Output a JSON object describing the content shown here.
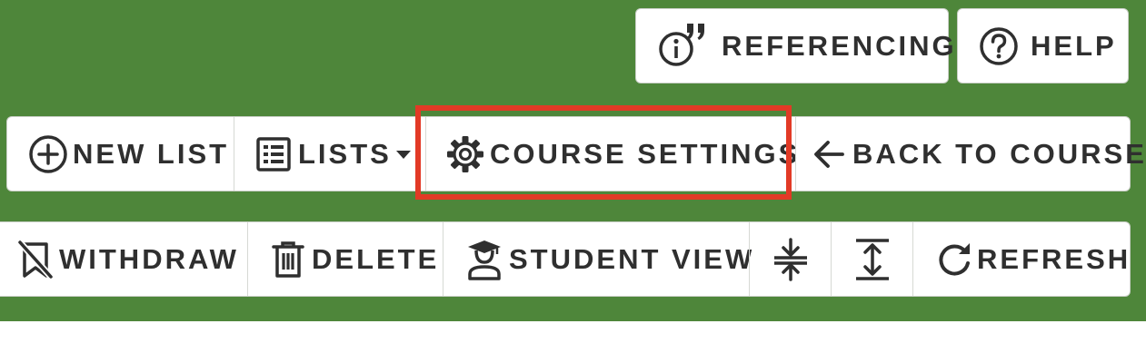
{
  "header": {
    "referencing_label": "REFERENCING",
    "help_label": "HELP"
  },
  "list_toolbar": {
    "new_list_label": "NEW LIST",
    "lists_label": "LISTS",
    "course_settings_label": "COURSE SETTINGS",
    "back_to_course_label": "BACK TO COURSE"
  },
  "item_toolbar": {
    "withdraw_label": "WITHDRAW",
    "delete_label": "DELETE",
    "student_view_label": "STUDENT VIEW",
    "refresh_label": "REFRESH"
  },
  "icons": {
    "referencing": "info-quote-icon",
    "help": "question-circle-icon",
    "new_list": "plus-circle-icon",
    "lists": "list-icon",
    "lists_dropdown": "caret-down-icon",
    "course_settings": "gear-icon",
    "back_to_course": "arrow-left-icon",
    "withdraw": "bookmark-off-icon",
    "delete": "trash-icon",
    "student_view": "student-icon",
    "collapse": "collapse-vertical-icon",
    "expand": "expand-vertical-icon",
    "refresh": "refresh-icon"
  },
  "colors": {
    "banner": "#4e863a",
    "highlight": "#e23a26",
    "text": "#2f2f2f"
  }
}
